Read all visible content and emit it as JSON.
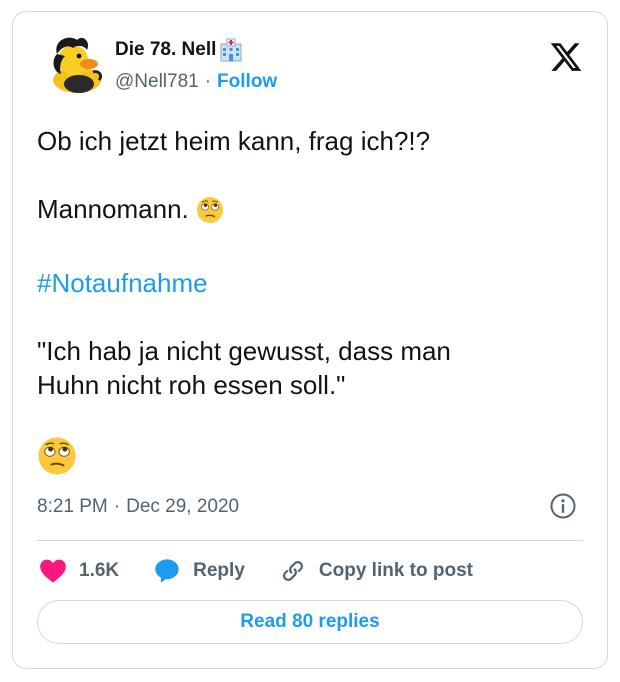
{
  "author": {
    "display_name": "Die 78. Nell",
    "handle": "@Nell781",
    "separator": "·",
    "follow_label": "Follow"
  },
  "tweet": {
    "line1": "Ob ich jetzt heim kann, frag ich?!?",
    "line2": "Mannomann.",
    "hashtag": "#Notaufnahme",
    "quote_line1": "\"Ich hab ja nicht gewusst, dass man",
    "quote_line2": "Huhn nicht roh essen soll.\""
  },
  "meta": {
    "time": "8:21 PM",
    "separator": "·",
    "date": "Dec 29, 2020"
  },
  "actions": {
    "like_count": "1.6K",
    "reply_label": "Reply",
    "copy_label": "Copy link to post"
  },
  "read_replies_label": "Read 80 replies",
  "colors": {
    "accent": "#1d9bf0",
    "like": "#f91880",
    "text": "#0f1419",
    "secondary": "#536471",
    "border": "#cfd9de"
  },
  "icons": [
    "hospital-icon",
    "x-logo-icon",
    "rolling-eyes-emoji",
    "info-icon",
    "heart-icon",
    "reply-bubble-icon",
    "link-icon"
  ]
}
